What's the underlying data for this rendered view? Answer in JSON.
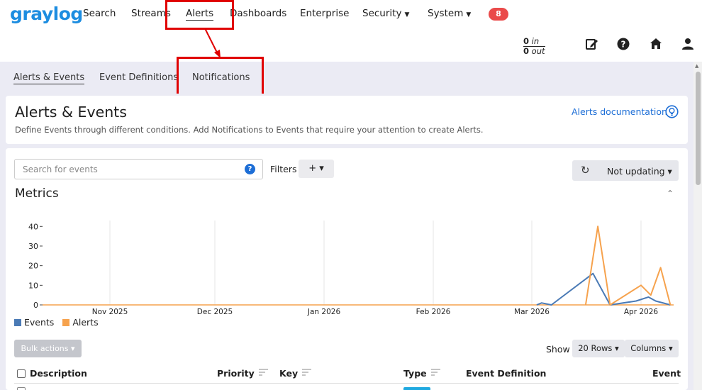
{
  "nav": {
    "logo": "graylog",
    "items": [
      {
        "label": "Search"
      },
      {
        "label": "Streams"
      },
      {
        "label": "Alerts"
      },
      {
        "label": "Dashboards"
      },
      {
        "label": "Enterprise"
      },
      {
        "label": "Security"
      },
      {
        "label": "System"
      }
    ],
    "badge": "8",
    "throughput_in_value": "0",
    "throughput_in_unit": "in",
    "throughput_out_value": "0",
    "throughput_out_unit": "out"
  },
  "subnav": {
    "tabs": [
      {
        "label": "Alerts & Events"
      },
      {
        "label": "Event Definitions"
      },
      {
        "label": "Notifications"
      }
    ]
  },
  "page": {
    "title": "Alerts & Events",
    "description": "Define Events through different conditions. Add Notifications to Events that require your attention to create Alerts.",
    "doc_link": "Alerts documentation"
  },
  "search": {
    "placeholder": "Search for events",
    "filters_label": "Filters",
    "filters_button": "+ ▾",
    "refresh_label": "Not updating ▾"
  },
  "metrics": {
    "title": "Metrics"
  },
  "chart_data": {
    "type": "line",
    "x_ticks": [
      "Nov 2025",
      "Dec 2025",
      "Jan 2026",
      "Feb 2026",
      "Mar 2026",
      "Apr 2026"
    ],
    "y_ticks": [
      "0",
      "10",
      "20",
      "30",
      "40"
    ],
    "ylim": [
      0,
      43
    ],
    "series": [
      {
        "name": "Events",
        "color": "#4a7ab5",
        "points": [
          [
            "Mar 2026 +0.2w",
            0
          ],
          [
            "Mar 2026 +0.4w",
            1
          ],
          [
            "Mar 2026 +0.8w",
            0
          ],
          [
            "Mar 2026 +2.5w",
            16
          ],
          [
            "Mar 2026 +3.2w",
            0
          ],
          [
            "Apr 2026 -0.2w",
            2
          ],
          [
            "Apr 2026 +0.3w",
            4
          ],
          [
            "Apr 2026 +0.6w",
            2
          ],
          [
            "Apr 2026 +1.2w",
            0
          ]
        ]
      },
      {
        "name": "Alerts",
        "color": "#f6a24d",
        "points": [
          [
            "Mar 2026 +2.2w",
            0
          ],
          [
            "Mar 2026 +2.7w",
            40
          ],
          [
            "Mar 2026 +3.2w",
            0
          ],
          [
            "Apr 2026 +0.0w",
            10
          ],
          [
            "Apr 2026 +0.4w",
            5
          ],
          [
            "Apr 2026 +0.8w",
            19
          ],
          [
            "Apr 2026 +1.2w",
            0
          ]
        ]
      }
    ],
    "grid": true,
    "legend": "bottom-left"
  },
  "legend": {
    "events": "Events",
    "alerts": "Alerts",
    "events_color": "#4a7ab5",
    "alerts_color": "#f6a24d"
  },
  "table": {
    "bulk_actions": "Bulk actions ▾",
    "show_label": "Show",
    "rows_button": "20 Rows ▾",
    "columns_button": "Columns ▾",
    "headers": [
      {
        "label": "Description"
      },
      {
        "label": "Priority"
      },
      {
        "label": "Key"
      },
      {
        "label": "Type"
      },
      {
        "label": "Event Definition"
      },
      {
        "label": "Event"
      }
    ]
  }
}
